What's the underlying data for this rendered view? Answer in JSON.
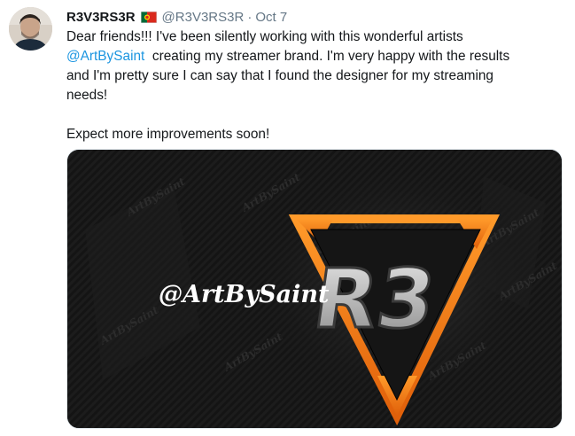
{
  "tweet": {
    "display_name": "R3V3RS3R",
    "handle": "@R3V3RS3R",
    "separator": "·",
    "date": "Oct 7",
    "text_line_1_start": "Dear friends!!! I've been silently working with this wonderful artists",
    "mention": "@ArtBySaint",
    "text_line_2_rest": "  creating my streamer brand. I'm very happy with the results",
    "text_line_3": "and I'm pretty sure I can say that I found the designer for my streaming",
    "text_line_4": "needs!",
    "text_line_5": "Expect more improvements soon!"
  },
  "media": {
    "signature": "@ArtBySaint",
    "logo_text": "R3",
    "watermark": "ArtBySaint"
  },
  "colors": {
    "mention": "#1b95e0",
    "muted": "#657786",
    "logo_orange": "#f07a12"
  },
  "icons": {
    "flag": "portugal-flag-icon"
  }
}
